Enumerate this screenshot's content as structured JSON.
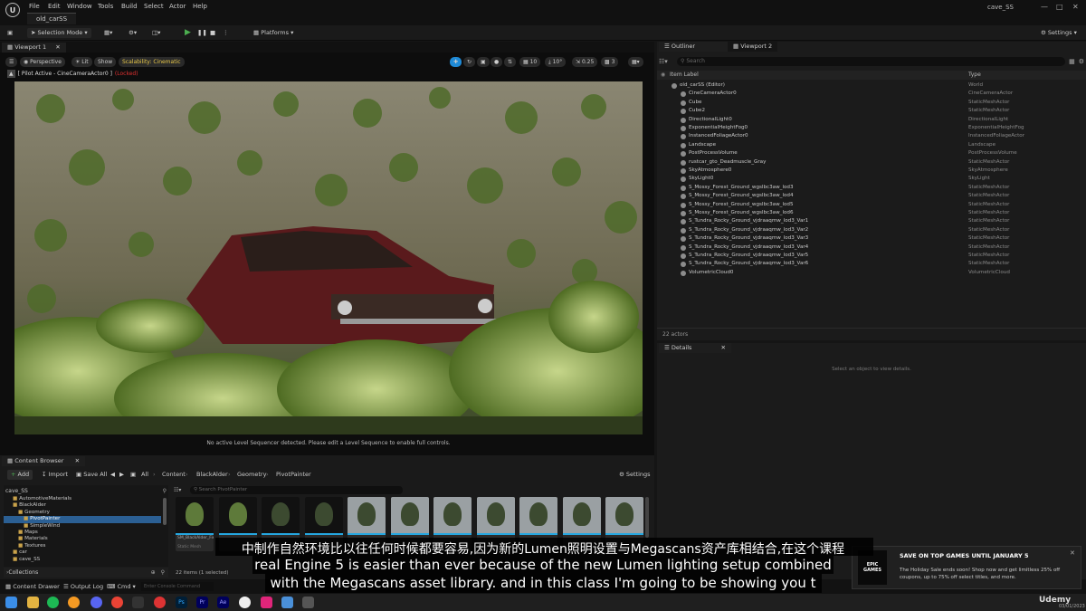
{
  "menubar": {
    "items": [
      "File",
      "Edit",
      "Window",
      "Tools",
      "Build",
      "Select",
      "Actor",
      "Help"
    ],
    "level_tab": "old_carSS",
    "project_name": "cave_SS"
  },
  "toolbar": {
    "mode": "Selection Mode",
    "platforms": "Platforms",
    "settings": "Settings"
  },
  "viewport": {
    "tab1": "Viewport 1",
    "perspective": "Perspective",
    "lit": "Lit",
    "show": "Show",
    "scalability": "Scalability: Cinematic",
    "pilot": "[ Pilot Active - CineCameraActor0 ]",
    "locked": "(Locked)",
    "grid_size": "10",
    "rot_size": "10°",
    "scale_size": "0.25",
    "cam_speed": "3",
    "no_sequence": "No active Level Sequencer detected. Please edit a Level Sequence to enable full controls."
  },
  "outliner": {
    "tab": "Outliner",
    "tab2": "Viewport 2",
    "search_placeholder": "Search",
    "col_label": "Item Label",
    "col_type": "Type",
    "rows": [
      {
        "name": "old_carSS (Editor)",
        "type": "World",
        "indent": 0
      },
      {
        "name": "CineCameraActor0",
        "type": "CineCameraActor",
        "indent": 1
      },
      {
        "name": "Cube",
        "type": "StaticMeshActor",
        "indent": 1
      },
      {
        "name": "Cube2",
        "type": "StaticMeshActor",
        "indent": 1
      },
      {
        "name": "DirectionalLight0",
        "type": "DirectionalLight",
        "indent": 1
      },
      {
        "name": "ExponentialHeightFog0",
        "type": "ExponentialHeightFog",
        "indent": 1
      },
      {
        "name": "InstancedFoliageActor0",
        "type": "InstancedFoliageActor",
        "indent": 1
      },
      {
        "name": "Landscape",
        "type": "Landscape",
        "indent": 1
      },
      {
        "name": "PostProcessVolume",
        "type": "PostProcessVolume",
        "indent": 1
      },
      {
        "name": "rustcar_gto_Deadmuscle_Gray",
        "type": "StaticMeshActor",
        "indent": 1
      },
      {
        "name": "SkyAtmosphere0",
        "type": "SkyAtmosphere",
        "indent": 1
      },
      {
        "name": "SkyLight0",
        "type": "SkyLight",
        "indent": 1
      },
      {
        "name": "S_Mossy_Forest_Ground_wgslbc3aw_lod3",
        "type": "StaticMeshActor",
        "indent": 1
      },
      {
        "name": "S_Mossy_Forest_Ground_wgslbc3aw_lod4",
        "type": "StaticMeshActor",
        "indent": 1
      },
      {
        "name": "S_Mossy_Forest_Ground_wgslbc3aw_lod5",
        "type": "StaticMeshActor",
        "indent": 1
      },
      {
        "name": "S_Mossy_Forest_Ground_wgslbc3aw_lod6",
        "type": "StaticMeshActor",
        "indent": 1
      },
      {
        "name": "S_Tundra_Rocky_Ground_vjdraaqmw_lod3_Var1",
        "type": "StaticMeshActor",
        "indent": 1
      },
      {
        "name": "S_Tundra_Rocky_Ground_vjdraaqmw_lod3_Var2",
        "type": "StaticMeshActor",
        "indent": 1
      },
      {
        "name": "S_Tundra_Rocky_Ground_vjdraaqmw_lod3_Var3",
        "type": "StaticMeshActor",
        "indent": 1
      },
      {
        "name": "S_Tundra_Rocky_Ground_vjdraaqmw_lod3_Var4",
        "type": "StaticMeshActor",
        "indent": 1
      },
      {
        "name": "S_Tundra_Rocky_Ground_vjdraaqmw_lod3_Var5",
        "type": "StaticMeshActor",
        "indent": 1
      },
      {
        "name": "S_Tundra_Rocky_Ground_vjdraaqmw_lod3_Var6",
        "type": "StaticMeshActor",
        "indent": 1
      },
      {
        "name": "VolumetricCloud0",
        "type": "VolumetricCloud",
        "indent": 1
      }
    ],
    "actor_count": "22 actors"
  },
  "details": {
    "tab": "Details",
    "empty_text": "Select an object to view details."
  },
  "content_browser": {
    "tab": "Content Browser",
    "add": "Add",
    "import": "Import",
    "save_all": "Save All",
    "path": [
      "All",
      "Content",
      "BlackAlder",
      "Geometry",
      "PivotPainter"
    ],
    "settings": "Settings",
    "tree_root": "cave_SS",
    "tree": [
      {
        "label": "AutomotiveMaterials",
        "indent": 1
      },
      {
        "label": "BlackAlder",
        "indent": 1
      },
      {
        "label": "Geometry",
        "indent": 2
      },
      {
        "label": "PivotPainter",
        "indent": 3,
        "selected": true
      },
      {
        "label": "SimpleWind",
        "indent": 3
      },
      {
        "label": "Maps",
        "indent": 2
      },
      {
        "label": "Materials",
        "indent": 2
      },
      {
        "label": "Textures",
        "indent": 2
      },
      {
        "label": "car",
        "indent": 1
      },
      {
        "label": "cave_SS",
        "indent": 1
      }
    ],
    "search_placeholder": "Search PivotPainter",
    "collections": "Collections",
    "item_count": "22 items (1 selected)",
    "assets": [
      {
        "label": "SM_BlackAlder_Field_01_FP",
        "sub": "Static Mesh"
      },
      {
        "label": "",
        "sub": ""
      },
      {
        "label": "",
        "sub": ""
      },
      {
        "label": "",
        "sub": ""
      },
      {
        "label": "",
        "sub": ""
      },
      {
        "label": "",
        "sub": ""
      },
      {
        "label": "",
        "sub": ""
      },
      {
        "label": "",
        "sub": ""
      },
      {
        "label": "",
        "sub": ""
      },
      {
        "label": "",
        "sub": ""
      },
      {
        "label": "",
        "sub": ""
      }
    ]
  },
  "statusbar": {
    "content_drawer": "Content Drawer",
    "output_log": "Output Log",
    "cmd": "Cmd",
    "console_placeholder": "Enter Console Command"
  },
  "subtitles": {
    "chinese": "中制作自然环境比以往任何时候都要容易,因为新的Lumen照明设置与Megascans资产库相结合,在这个课程",
    "line1": "real Engine 5 is easier than ever because of the new Lumen lighting setup combined",
    "line2": "with the Megascans asset library. and in this class I'm going to be showing you t"
  },
  "notification": {
    "title": "SAVE ON TOP GAMES UNTIL JANUARY 5",
    "body": "The Holiday Sale ends soon! Shop now and get limitless 25% off coupons, up to 75% off select titles, and more.",
    "logo": "EPIC GAMES"
  },
  "taskbar": {
    "watermark": "Udemy",
    "date": "03/01/2023"
  },
  "colors": {
    "accent_blue": "#1f8ad6",
    "locked_red": "#e03030",
    "scalability_yellow": "#e8c84a",
    "play_green": "#4caf50"
  }
}
